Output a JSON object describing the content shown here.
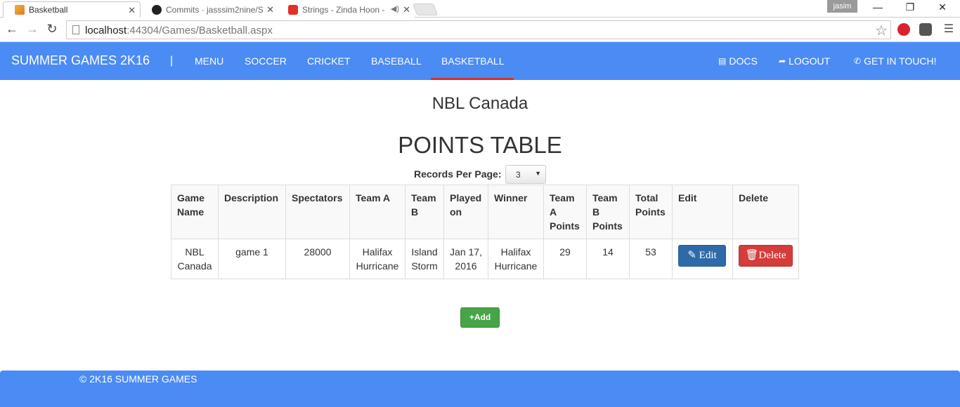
{
  "browser": {
    "tabs": [
      {
        "title": "Basketball",
        "active": true
      },
      {
        "title": "Commits · jasssim2nine/S",
        "active": false
      },
      {
        "title": "Strings - Zinda Hoon -",
        "active": false
      }
    ],
    "user": "jasim",
    "controls": {
      "minimize": "—",
      "restore": "❐",
      "close": "✕"
    },
    "url_host": "localhost",
    "url_rest": ":44304/Games/Basketball.aspx"
  },
  "navbar": {
    "brand": "SUMMER GAMES 2K16",
    "separator": "|",
    "items": [
      "MENU",
      "SOCCER",
      "CRICKET",
      "BASEBALL",
      "BASKETBALL"
    ],
    "active_item": "BASKETBALL",
    "right": {
      "docs": "DOCS",
      "logout": "LOGOUT",
      "contact": "GET IN TOUCH!"
    }
  },
  "main": {
    "league": "NBL Canada",
    "title": "POINTS TABLE",
    "records_label": "Records Per Page:",
    "records_value": "3",
    "table": {
      "headers": [
        "Game Name",
        "Description",
        "Spectators",
        "Team A",
        "Team B",
        "Played on",
        "Winner",
        "Team A Points",
        "Team B Points",
        "Total Points",
        "Edit",
        "Delete"
      ],
      "rows": [
        {
          "game_name": "NBL Canada",
          "description": "game 1",
          "spectators": "28000",
          "team_a": "Halifax Hurricane",
          "team_b": "Island Storm",
          "played_on": "Jan 17, 2016",
          "winner": "Halifax Hurricane",
          "team_a_points": "29",
          "team_b_points": "14",
          "total_points": "53",
          "edit_label": "Edit",
          "delete_label": "Delete"
        }
      ]
    },
    "add_label": "Add"
  },
  "footer": {
    "text": "© 2K16 SUMMER GAMES"
  },
  "colors": {
    "navbar": "#4b8bf4",
    "active_underline": "#d22f2f",
    "edit": "#2f6aa8",
    "delete": "#d53d3a",
    "add": "#47a447"
  }
}
